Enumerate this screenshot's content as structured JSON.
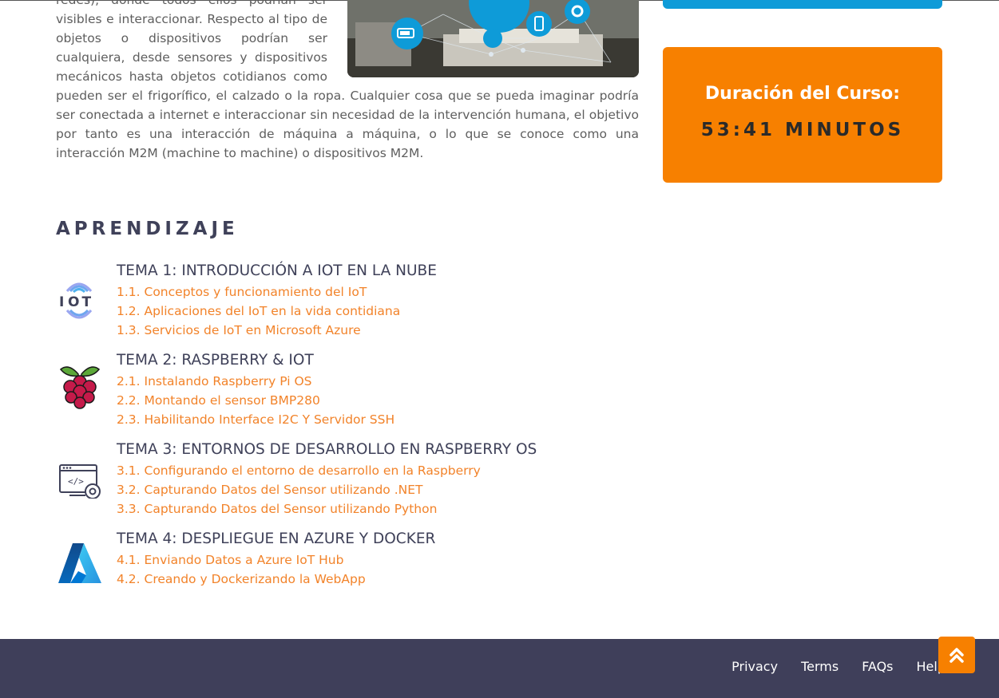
{
  "intro": {
    "paragraph": "redes), donde todos ellos podrían ser visibles e interaccionar. Respecto al tipo de objetos o dispositivos podrían ser cualquiera, desde sensores y dispositivos mecánicos hasta objetos cotidianos como pueden ser el frigorífico, el calzado o la ropa. Cualquier cosa que se pueda imaginar podría ser conectada a internet e interaccionar sin necesidad de la intervención humana, el objetivo por tanto es una interacción de máquina a máquina, o lo que se conoce como una interacción M2M (machine to machine) o dispositivos M2M."
  },
  "sidebar": {
    "duration_label": "Duración del Curso:",
    "duration_value": "53:41 MINUTOS"
  },
  "learning": {
    "title": "APRENDIZAJE",
    "modules": [
      {
        "icon": "iot-icon",
        "title": "TEMA 1: INTRODUCCIÓN A IOT EN LA NUBE",
        "lessons": [
          "1.1. Conceptos y funcionamiento del IoT",
          "1.2. Aplicaciones del IoT en la vida contidiana",
          "1.3. Servicios de IoT en Microsoft Azure"
        ]
      },
      {
        "icon": "raspberry-pi-icon",
        "title": "TEMA 2: RASPBERRY & IOT",
        "lessons": [
          "2.1. Instalando Raspberry Pi OS",
          "2.2. Montando el sensor BMP280",
          "2.3. Habilitando Interface I2C Y Servidor SSH"
        ]
      },
      {
        "icon": "dev-environment-icon",
        "title": "TEMA 3: ENTORNOS DE DESARROLLO EN RASPBERRY OS",
        "lessons": [
          "3.1. Configurando el entorno de desarrollo en la Raspberry",
          "3.2. Capturando Datos del Sensor utilizando .NET",
          "3.3. Capturando Datos del Sensor utilizando Python"
        ]
      },
      {
        "icon": "azure-icon",
        "title": "TEMA 4: DESPLIEGUE EN AZURE Y DOCKER",
        "lessons": [
          "4.1. Enviando Datos a Azure IoT Hub",
          "4.2. Creando y Dockerizando la WebApp"
        ]
      }
    ]
  },
  "footer": {
    "links": [
      "Privacy",
      "Terms",
      "FAQs",
      "Help"
    ]
  },
  "colors": {
    "accent": "#f78000",
    "link": "#f2832a",
    "heading": "#3f4159",
    "footer_bg": "#3f3f5a",
    "sidebar_tab": "#0e9bd8"
  },
  "icons": {
    "scroll_top": "double-chevron-up-icon"
  }
}
